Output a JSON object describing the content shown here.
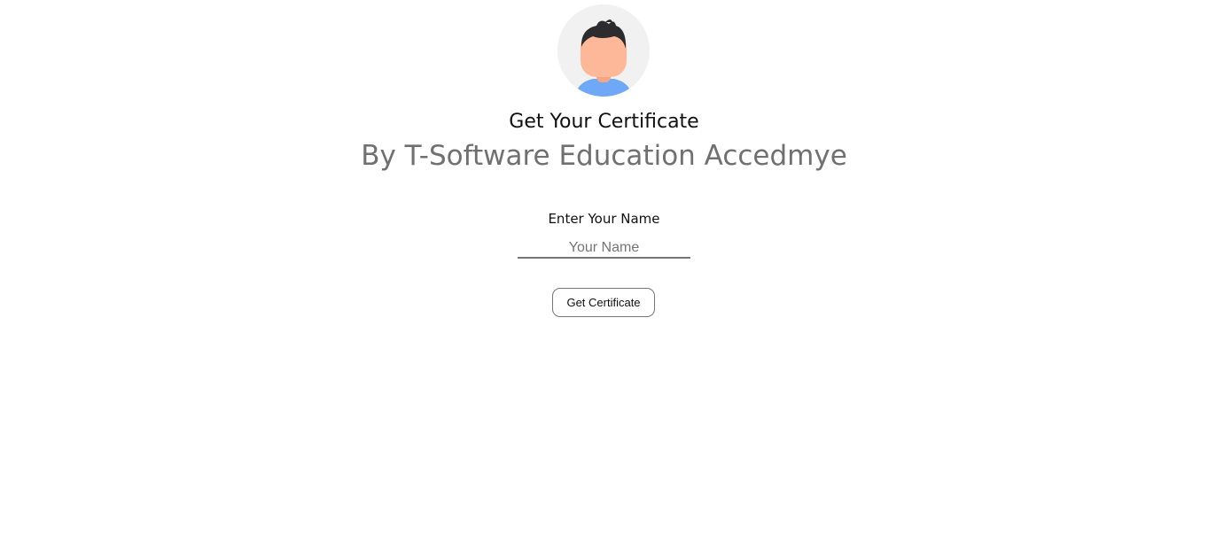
{
  "header": {
    "title": "Get Your Certificate",
    "subtitle": "By T-Software Education Accedmye"
  },
  "form": {
    "name_label": "Enter Your Name",
    "name_placeholder": "Your Name",
    "name_value": "",
    "submit_label": "Get Certificate"
  },
  "colors": {
    "subtitle": "#707070",
    "avatar_background": "#f1f1f2",
    "avatar_skin": "#fdb89a",
    "avatar_hair": "#2c2c2e",
    "avatar_shirt": "#6ea8f7"
  },
  "icons": {
    "avatar": "user-avatar-icon"
  }
}
